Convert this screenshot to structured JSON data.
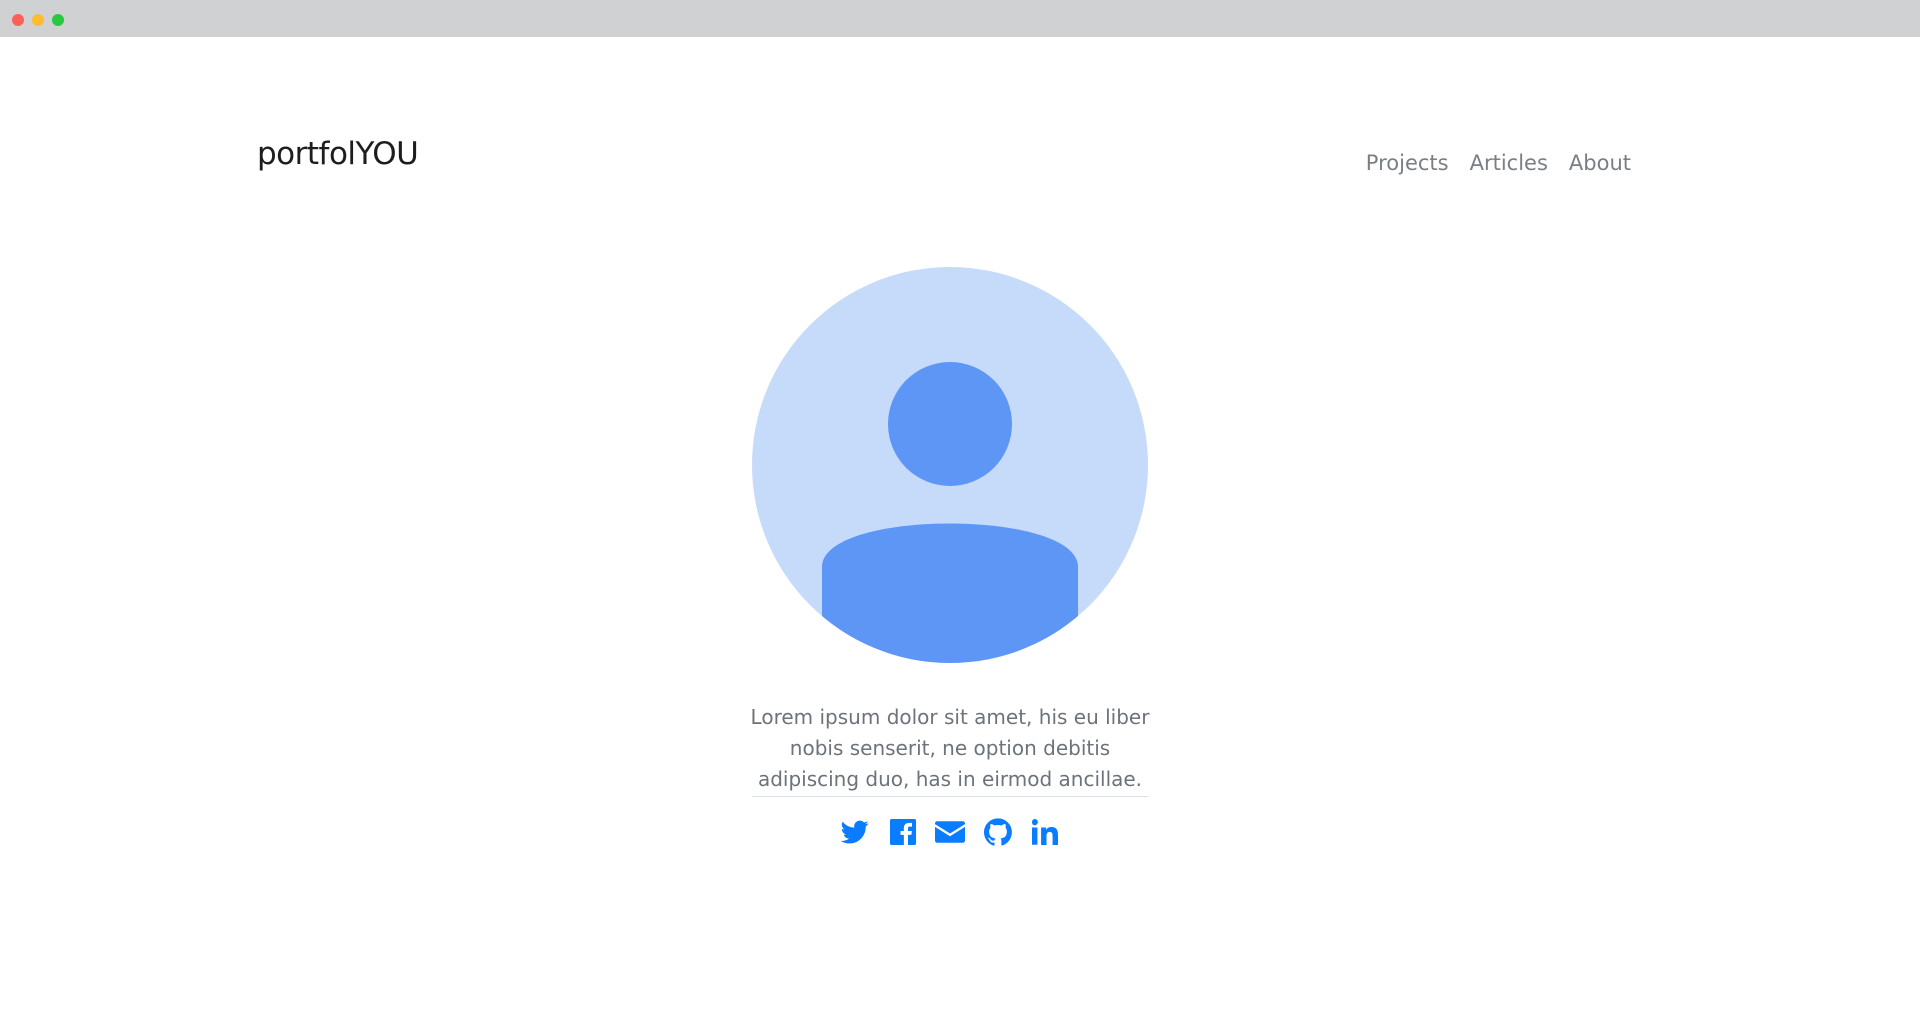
{
  "brand": {
    "name": "portfolYOU"
  },
  "nav": {
    "items": [
      {
        "label": "Projects"
      },
      {
        "label": "Articles"
      },
      {
        "label": "About"
      }
    ]
  },
  "profile": {
    "avatar_icon": "user-avatar-icon",
    "bio": "Lorem ipsum dolor sit amet, his eu liber nobis senserit, ne option debitis adipiscing duo, has in eirmod ancillae."
  },
  "social": {
    "items": [
      {
        "icon": "twitter-icon"
      },
      {
        "icon": "facebook-icon"
      },
      {
        "icon": "email-icon"
      },
      {
        "icon": "github-icon"
      },
      {
        "icon": "linkedin-icon"
      }
    ]
  },
  "colors": {
    "accent": "#0a7cff",
    "avatar_bg": "#c6daf9",
    "avatar_fg": "#5e96f5",
    "nav_text": "#7a7f86",
    "body_text": "#6c737b",
    "titlebar": "#d0d1d3"
  }
}
